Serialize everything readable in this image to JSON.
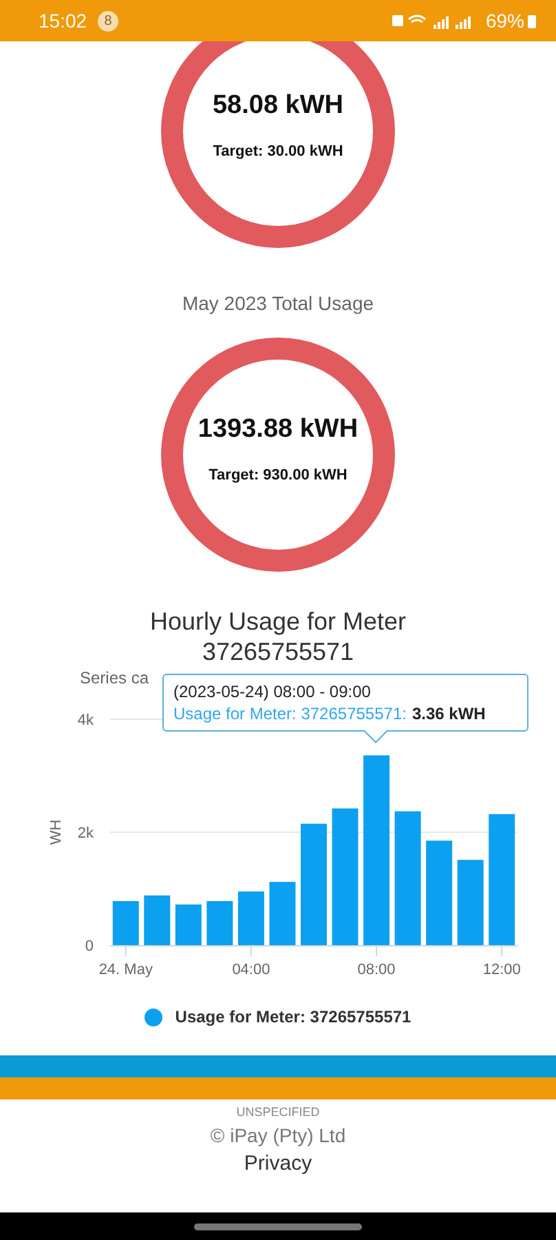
{
  "status_bar": {
    "time": "15:02",
    "notification_count": "8",
    "battery": "69%"
  },
  "gauges": [
    {
      "value": "58.08 kWH",
      "target": "Target: 30.00 kWH"
    },
    {
      "caption": "May 2023 Total Usage",
      "value": "1393.88 kWH",
      "target": "Target: 930.00 kWH"
    }
  ],
  "chart_section": {
    "title": "Hourly Usage for Meter",
    "meter": "37265755571",
    "subtitle": "Series ca",
    "chart_data": {
      "type": "bar",
      "ylabel": "WH",
      "x": [
        0,
        1,
        2,
        3,
        4,
        5,
        6,
        7,
        8,
        9,
        10,
        11,
        12
      ],
      "series": [
        {
          "name": "Usage for Meter: 37265755571",
          "color": "#0ca0f0",
          "values": [
            780,
            880,
            720,
            780,
            950,
            1120,
            2150,
            2420,
            3360,
            2370,
            1850,
            1510,
            2320
          ]
        }
      ],
      "xlim": [
        -0.5,
        12.5
      ],
      "ylim": [
        0,
        4000
      ],
      "yticks": [
        0,
        {
          "value": 2000,
          "label": "2k"
        },
        {
          "value": 4000,
          "label": "4k"
        }
      ],
      "xticks": [
        {
          "value": 0,
          "label": "24. May"
        },
        {
          "value": 4,
          "label": "04:00"
        },
        {
          "value": 8,
          "label": "08:00"
        },
        {
          "value": 12,
          "label": "12:00"
        }
      ]
    },
    "tooltip": {
      "title": "(2023-05-24) 08:00 - 09:00",
      "series": "Usage for Meter: 37265755571:",
      "value": "3.36 kWH"
    }
  },
  "footer": {
    "environment": "UNSPECIFIED",
    "copyright": "© iPay (Pty) Ltd",
    "link": "Privacy"
  }
}
